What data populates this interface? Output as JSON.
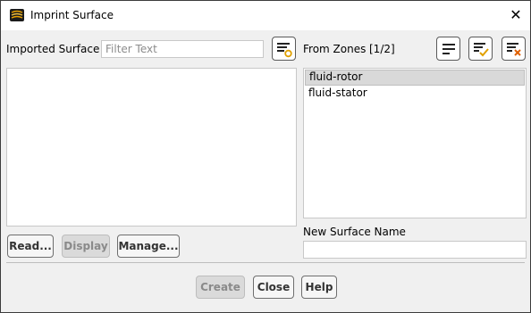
{
  "window": {
    "title": "Imprint Surface"
  },
  "imported_surface": {
    "label": "Imported Surface",
    "filter_placeholder": "Filter Text",
    "items": []
  },
  "from_zones": {
    "label": "From Zones",
    "count": "[1/2]",
    "items": [
      "fluid-rotor",
      "fluid-stator"
    ],
    "selected": "fluid-rotor"
  },
  "left_buttons": {
    "read": "Read...",
    "display": "Display",
    "manage": "Manage..."
  },
  "new_surface": {
    "label": "New Surface Name",
    "value": ""
  },
  "footer": {
    "create": "Create",
    "close": "Close",
    "help": "Help"
  },
  "colors": {
    "selection": "#d9d9d9",
    "dialog_bg": "#f0f0f0",
    "accent_check": "#e0a000",
    "accent_x": "#e06000"
  }
}
